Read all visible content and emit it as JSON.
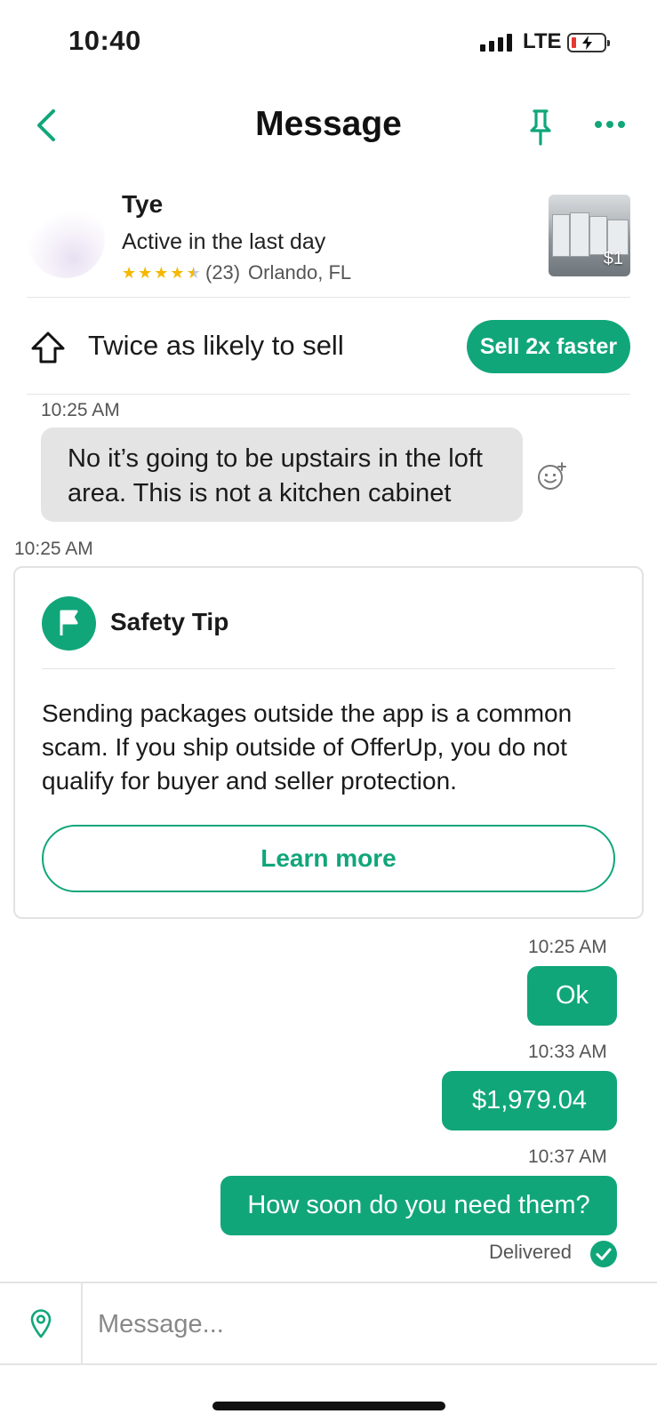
{
  "status_bar": {
    "time": "10:40",
    "network": "LTE",
    "battery_charging": true
  },
  "header": {
    "title": "Message",
    "back_icon": "chevron-left-icon",
    "pin_icon": "pin-icon",
    "more_icon": "more-horizontal-icon"
  },
  "seller": {
    "name": "Tye",
    "status": "Active in the last day",
    "rating_stars": 4.5,
    "rating_count": "(23)",
    "location": "Orlando, FL"
  },
  "listing": {
    "price": "$1"
  },
  "promo": {
    "text": "Twice as likely to sell",
    "button": "Sell 2x faster",
    "icon": "arrow-up-outline-icon"
  },
  "messages": [
    {
      "time": "10:25 AM",
      "direction": "incoming",
      "text": "No it’s going to be upstairs in the loft area. This is not a kitchen cabinet"
    },
    {
      "time": "10:25 AM",
      "type": "safety_tip"
    },
    {
      "time": "10:25 AM",
      "direction": "outgoing",
      "text": "Ok"
    },
    {
      "time": "10:33 AM",
      "direction": "outgoing",
      "text": "$1,979.04"
    },
    {
      "time": "10:37 AM",
      "direction": "outgoing",
      "text": "How soon do you need them?"
    }
  ],
  "safety_tip": {
    "title": "Safety Tip",
    "body": "Sending packages outside the app is a common scam. If you ship outside of OfferUp, you do not qualify for buyer and seller protection.",
    "button": "Learn more",
    "icon": "flag-icon"
  },
  "delivery_status": "Delivered",
  "composer": {
    "placeholder": "Message...",
    "location_icon": "location-pin-icon"
  },
  "colors": {
    "accent": "#11a67a",
    "incoming_bubble": "#e4e4e4",
    "star": "#f5b800"
  }
}
